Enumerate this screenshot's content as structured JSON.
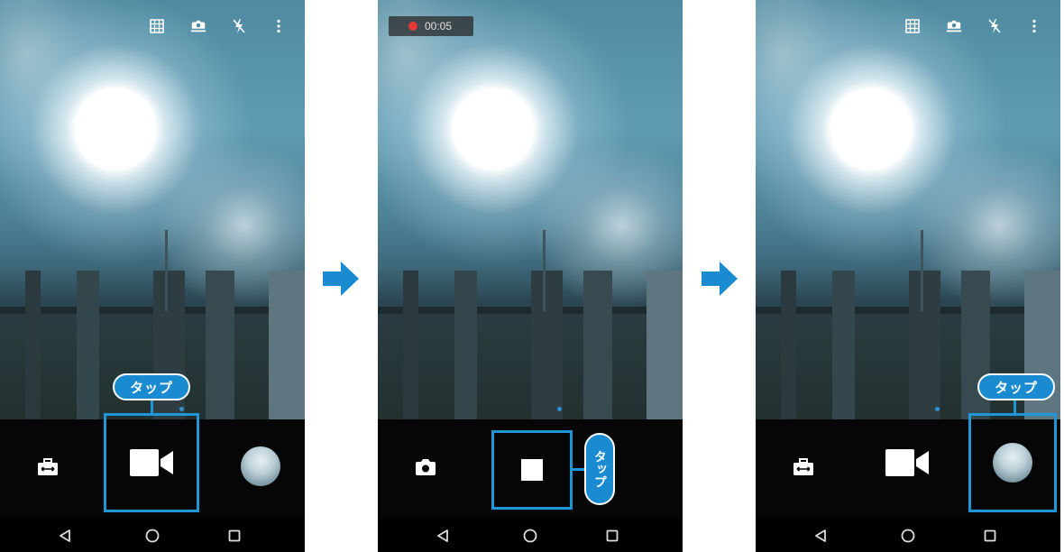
{
  "steps": [
    {
      "screen": "video-standby",
      "top_icons": [
        "grid-icon",
        "camera-switch-icon",
        "flash-off-icon",
        "more-vert-icon"
      ],
      "mode_icon": "briefcase-icon",
      "shutter_icon": "video-camera-icon",
      "callout": "タップ"
    },
    {
      "screen": "recording",
      "recording_time": "00:05",
      "mode_icon": "camera-icon",
      "shutter_icon": "stop-icon",
      "callout": "タップ"
    },
    {
      "screen": "after-recording",
      "top_icons": [
        "grid-icon",
        "camera-switch-icon",
        "flash-off-icon",
        "more-vert-icon"
      ],
      "mode_icon": "briefcase-icon",
      "shutter_icon": "video-camera-icon",
      "callout": "タップ"
    }
  ],
  "nav_icons": [
    "back-icon",
    "home-icon",
    "recents-icon"
  ],
  "colors": {
    "accent": "#1a8bd0",
    "highlight": "#1f96d8",
    "record": "#e53935",
    "bar": "#060606"
  }
}
